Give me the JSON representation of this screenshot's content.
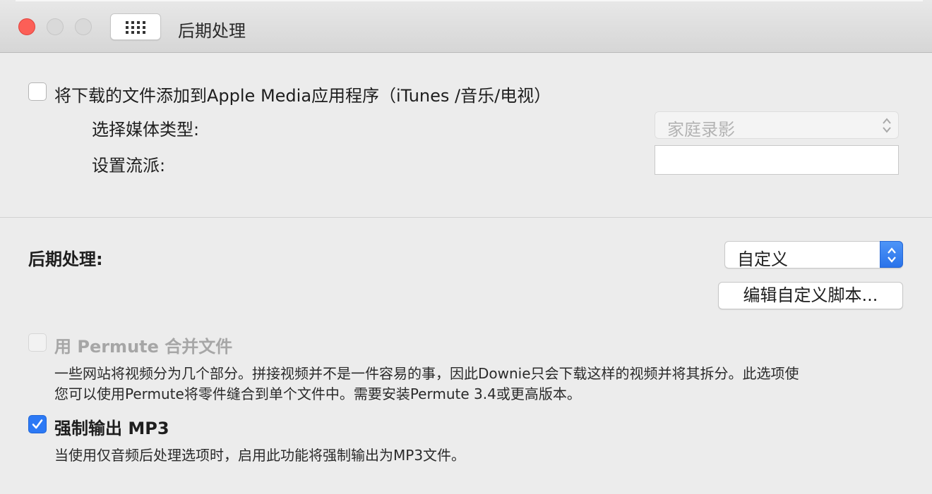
{
  "window": {
    "title": "后期处理"
  },
  "media_section": {
    "add_to_media_app_label": "将下载的文件添加到Apple Media应用程序（iTunes /音乐/电视）",
    "add_to_media_app_checked": false,
    "media_type_label": "选择媒体类型:",
    "media_type_value": "家庭录影",
    "genre_label": "设置流派:",
    "genre_value": ""
  },
  "postprocessing_section": {
    "label": "后期处理:",
    "mode_value": "自定义",
    "edit_script_button": "编辑自定义脚本..."
  },
  "permute": {
    "label": "用 Permute 合并文件",
    "checked": false,
    "enabled": false,
    "description_line1": "一些网站将视频分为几个部分。拼接视频并不是一件容易的事，因此Downie只会下载这样的视频并将其拆分。此选项使",
    "description_line2": "您可以使用Permute将零件缝合到单个文件中。需要安装Permute 3.4或更高版本。"
  },
  "force_mp3": {
    "label": "强制输出 MP3",
    "checked": true,
    "description": "当使用仅音频后处理选项时，启用此功能将强制输出为MP3文件。"
  },
  "colors": {
    "accent": "#2c79f5",
    "close_button": "#fc5f57",
    "background": "#ececec"
  },
  "icons": {
    "close": "close-traffic-light",
    "minimize": "minimize-traffic-light",
    "zoom": "zoom-traffic-light",
    "grid": "grid-icon",
    "checkmark": "checkmark-icon",
    "chevrons": "up-down-chevron-icon"
  }
}
